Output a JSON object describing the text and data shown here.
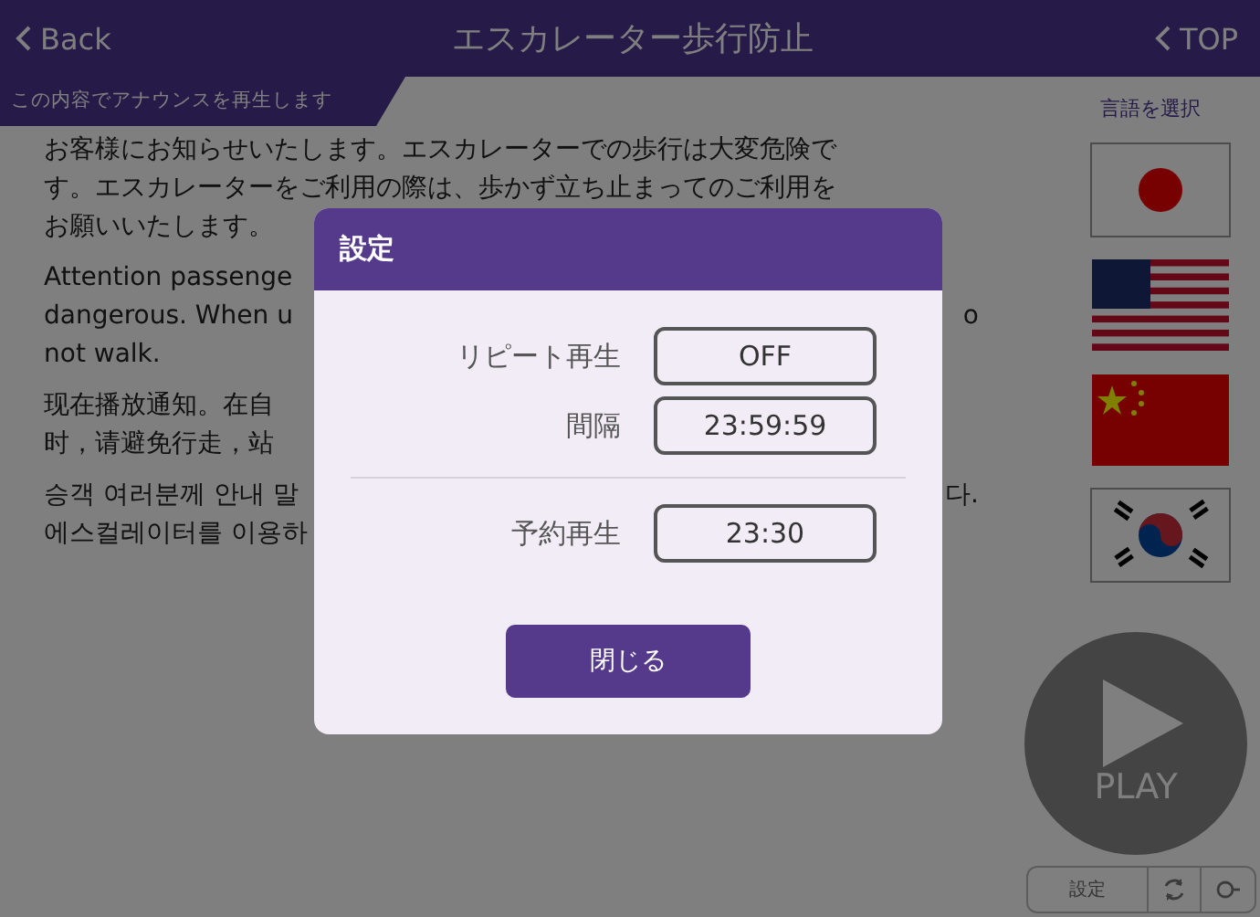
{
  "header": {
    "back": "Back",
    "title": "エスカレーター歩行防止",
    "top": "TOP"
  },
  "banner": "この内容でアナウンスを再生します",
  "paragraphs": [
    {
      "lines": [
        {
          "left": "お客様にお知らせいたします。エスカレーターでの歩行は大変危険で"
        },
        {
          "left": "す。エスカレーターをご利用の際は、歩かず立ち止まってのご利用を"
        },
        {
          "left": "お願いいたします。"
        }
      ]
    },
    {
      "lines": [
        {
          "left": "Attention passenge"
        },
        {
          "left": "dangerous. When u",
          "right": "o"
        },
        {
          "left": "not walk."
        }
      ]
    },
    {
      "lines": [
        {
          "left": "现在播放通知。在自"
        },
        {
          "left": "时，请避免行走，站"
        }
      ]
    },
    {
      "lines": [
        {
          "left": "승객 여러분께 안내 말",
          "right": "다."
        },
        {
          "left": "에스컬레이터를 이용하"
        }
      ]
    }
  ],
  "language": {
    "title": "言語を選択",
    "flags": [
      {
        "kind": "japan"
      },
      {
        "kind": "usa"
      },
      {
        "kind": "china"
      },
      {
        "kind": "korea"
      }
    ]
  },
  "play": "PLAY",
  "controls": {
    "settings": "設定"
  },
  "dialog": {
    "title": "設定",
    "groups": [
      [
        {
          "label": "リピート再生",
          "value": "OFF"
        },
        {
          "label": "間隔",
          "value": "23:59:59"
        }
      ],
      [
        {
          "label": "予約再生",
          "value": "23:30"
        }
      ]
    ],
    "close": "閉じる"
  }
}
